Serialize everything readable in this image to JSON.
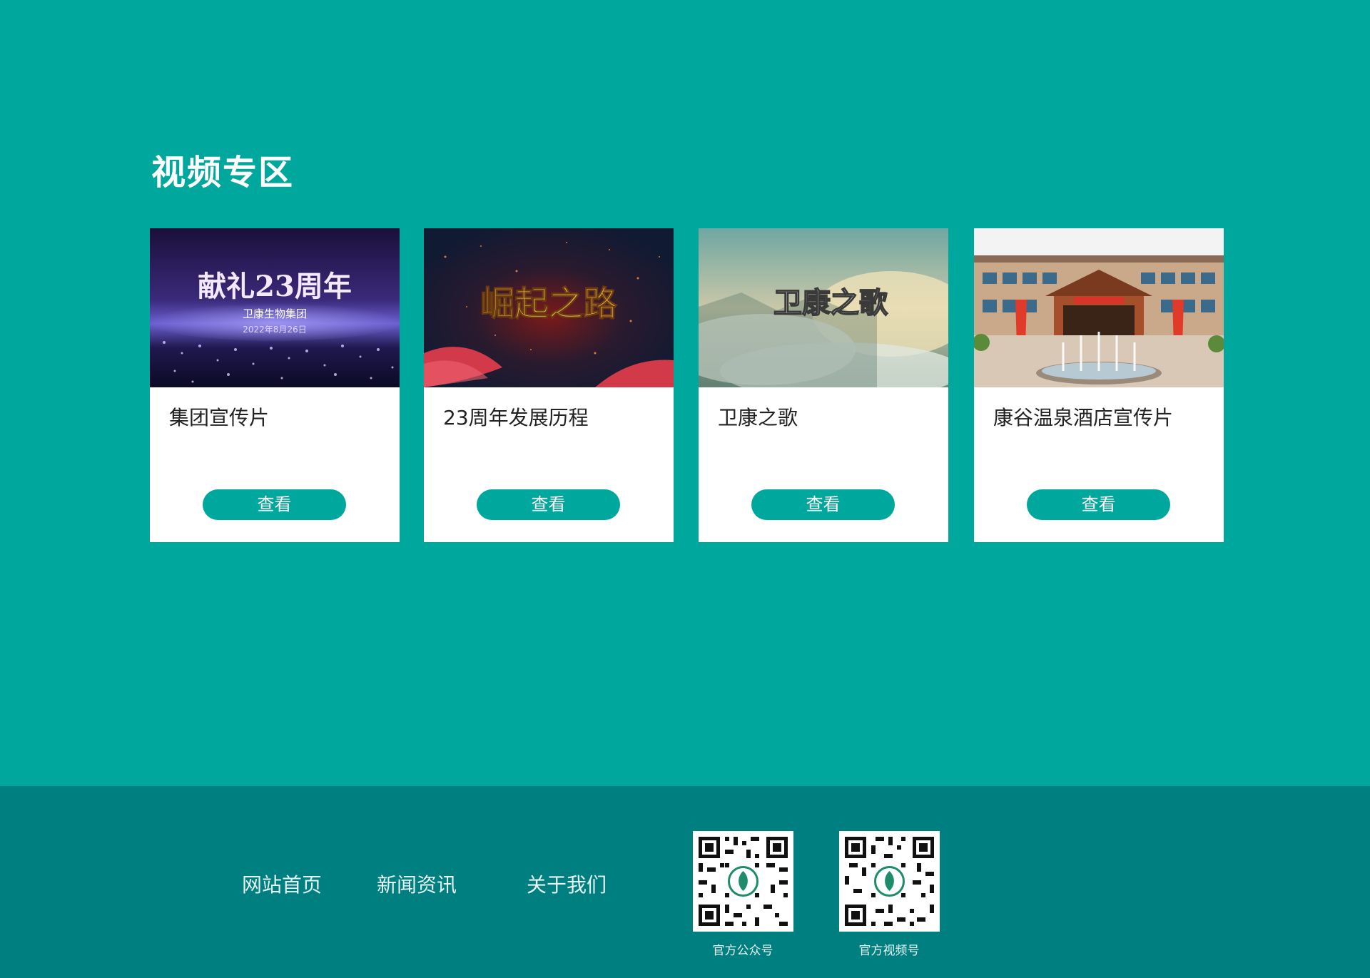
{
  "section": {
    "title": "视频专区"
  },
  "cards": [
    {
      "title": "集团宣传片",
      "button": "查看",
      "thumb_text": "献礼23周年",
      "thumb_subtext": "卫康生物集团",
      "thumb_date": "2022年8月26日"
    },
    {
      "title": "23周年发展历程",
      "button": "查看",
      "thumb_text": "崛起之路"
    },
    {
      "title": "卫康之歌",
      "button": "查看",
      "thumb_text": "卫康之歌"
    },
    {
      "title": "康谷温泉酒店宣传片",
      "button": "查看"
    }
  ],
  "footer": {
    "links": [
      "网站首页",
      "新闻资讯",
      "关于我们"
    ],
    "qr_codes": [
      {
        "caption": "官方公众号"
      },
      {
        "caption": "官方视频号"
      }
    ]
  },
  "colors": {
    "primary": "#00A79D",
    "footer": "#007F80"
  },
  "icons": [
    "qr-code-icon",
    "logo-icon"
  ]
}
